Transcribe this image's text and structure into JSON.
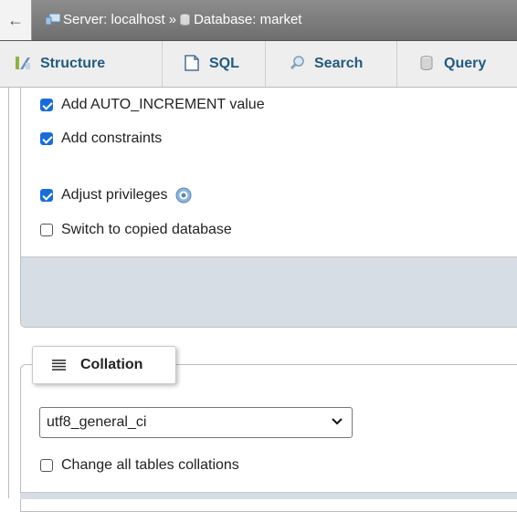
{
  "breadcrumb": {
    "server": "Server: localhost",
    "separator": "»",
    "database": "Database: market"
  },
  "tabs": [
    {
      "label": "Structure",
      "icon": "structure-icon"
    },
    {
      "label": "SQL",
      "icon": "sql-icon"
    },
    {
      "label": "Search",
      "icon": "search-icon"
    },
    {
      "label": "Query",
      "icon": "query-icon"
    }
  ],
  "options": {
    "auto_increment": {
      "label": "Add AUTO_INCREMENT value",
      "checked": true
    },
    "constraints": {
      "label": "Add constraints",
      "checked": true
    },
    "privileges": {
      "label": "Adjust privileges",
      "checked": true
    },
    "switch_db": {
      "label": "Switch to copied database",
      "checked": false
    }
  },
  "collation": {
    "legend": "Collation",
    "selected": "utf8_general_ci",
    "change_all": {
      "label": "Change all tables collations",
      "checked": false
    }
  },
  "colors": {
    "link": "#235a81",
    "checkbox": "#1a6dd6",
    "footer_panel": "#d6dde4"
  }
}
